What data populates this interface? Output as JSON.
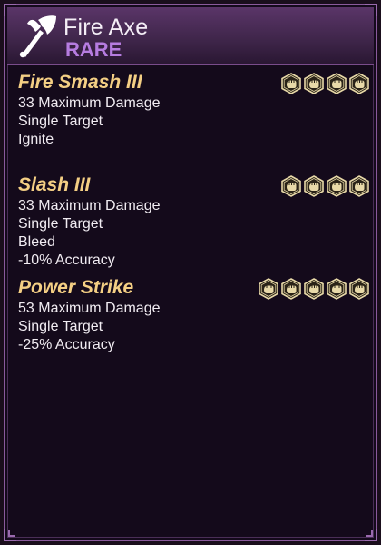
{
  "item": {
    "name": "Fire Axe",
    "rarity": "RARE",
    "icon": "axe-icon"
  },
  "abilities": [
    {
      "name": "Fire Smash III",
      "stats": [
        "33 Maximum Damage",
        "Single Target",
        "Ignite"
      ],
      "cost": 4
    },
    {
      "name": "Slash III",
      "stats": [
        "33 Maximum Damage",
        "Single Target",
        "Bleed",
        "-10% Accuracy"
      ],
      "cost": 4
    },
    {
      "name": "Power Strike",
      "stats": [
        "53 Maximum Damage",
        "Single Target",
        "-25% Accuracy"
      ],
      "cost": 5
    }
  ],
  "colors": {
    "rarity": "#b67ce0",
    "ability_name": "#f4cf84",
    "cost_icon": "#e8d9a8",
    "frame": "#8a5a9c"
  },
  "cost_icon": "strength-fist-icon"
}
